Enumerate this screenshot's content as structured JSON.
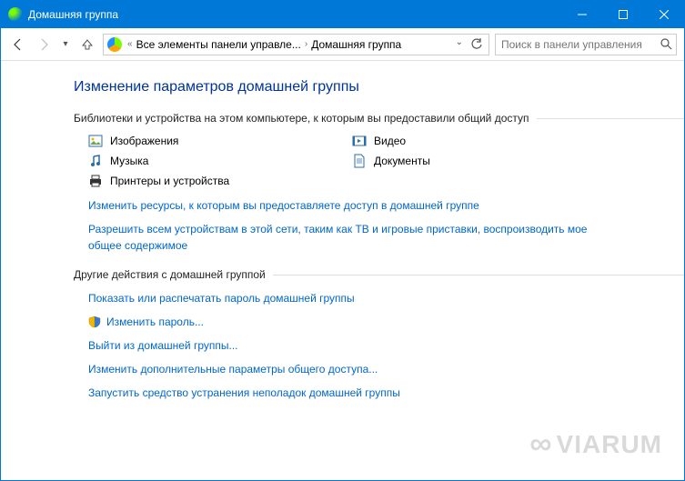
{
  "window": {
    "title": "Домашняя группа"
  },
  "breadcrumb": {
    "root": "Все элементы панели управле...",
    "current": "Домашняя группа"
  },
  "search": {
    "placeholder": "Поиск в панели управления"
  },
  "page": {
    "heading": "Изменение параметров домашней группы",
    "group1_label": "Библиотеки и устройства на этом компьютере, к которым вы предоставили общий доступ",
    "libs": {
      "images": "Изображения",
      "video": "Видео",
      "music": "Музыка",
      "documents": "Документы",
      "printers": "Принтеры и устройства"
    },
    "links1": {
      "change_share": "Изменить ресурсы, к которым вы предоставляете доступ в домашней группе",
      "allow_devices": "Разрешить всем устройствам в этой сети, таким как ТВ и игровые приставки, воспроизводить мое общее содержимое"
    },
    "group2_label": "Другие действия с домашней группой",
    "links2": {
      "show_password": "Показать или распечатать пароль домашней группы",
      "change_password": "Изменить пароль...",
      "leave": "Выйти из домашней группы...",
      "advanced": "Изменить дополнительные параметры общего доступа...",
      "troubleshoot": "Запустить средство устранения неполадок домашней группы"
    }
  },
  "watermark": "VIARUM"
}
